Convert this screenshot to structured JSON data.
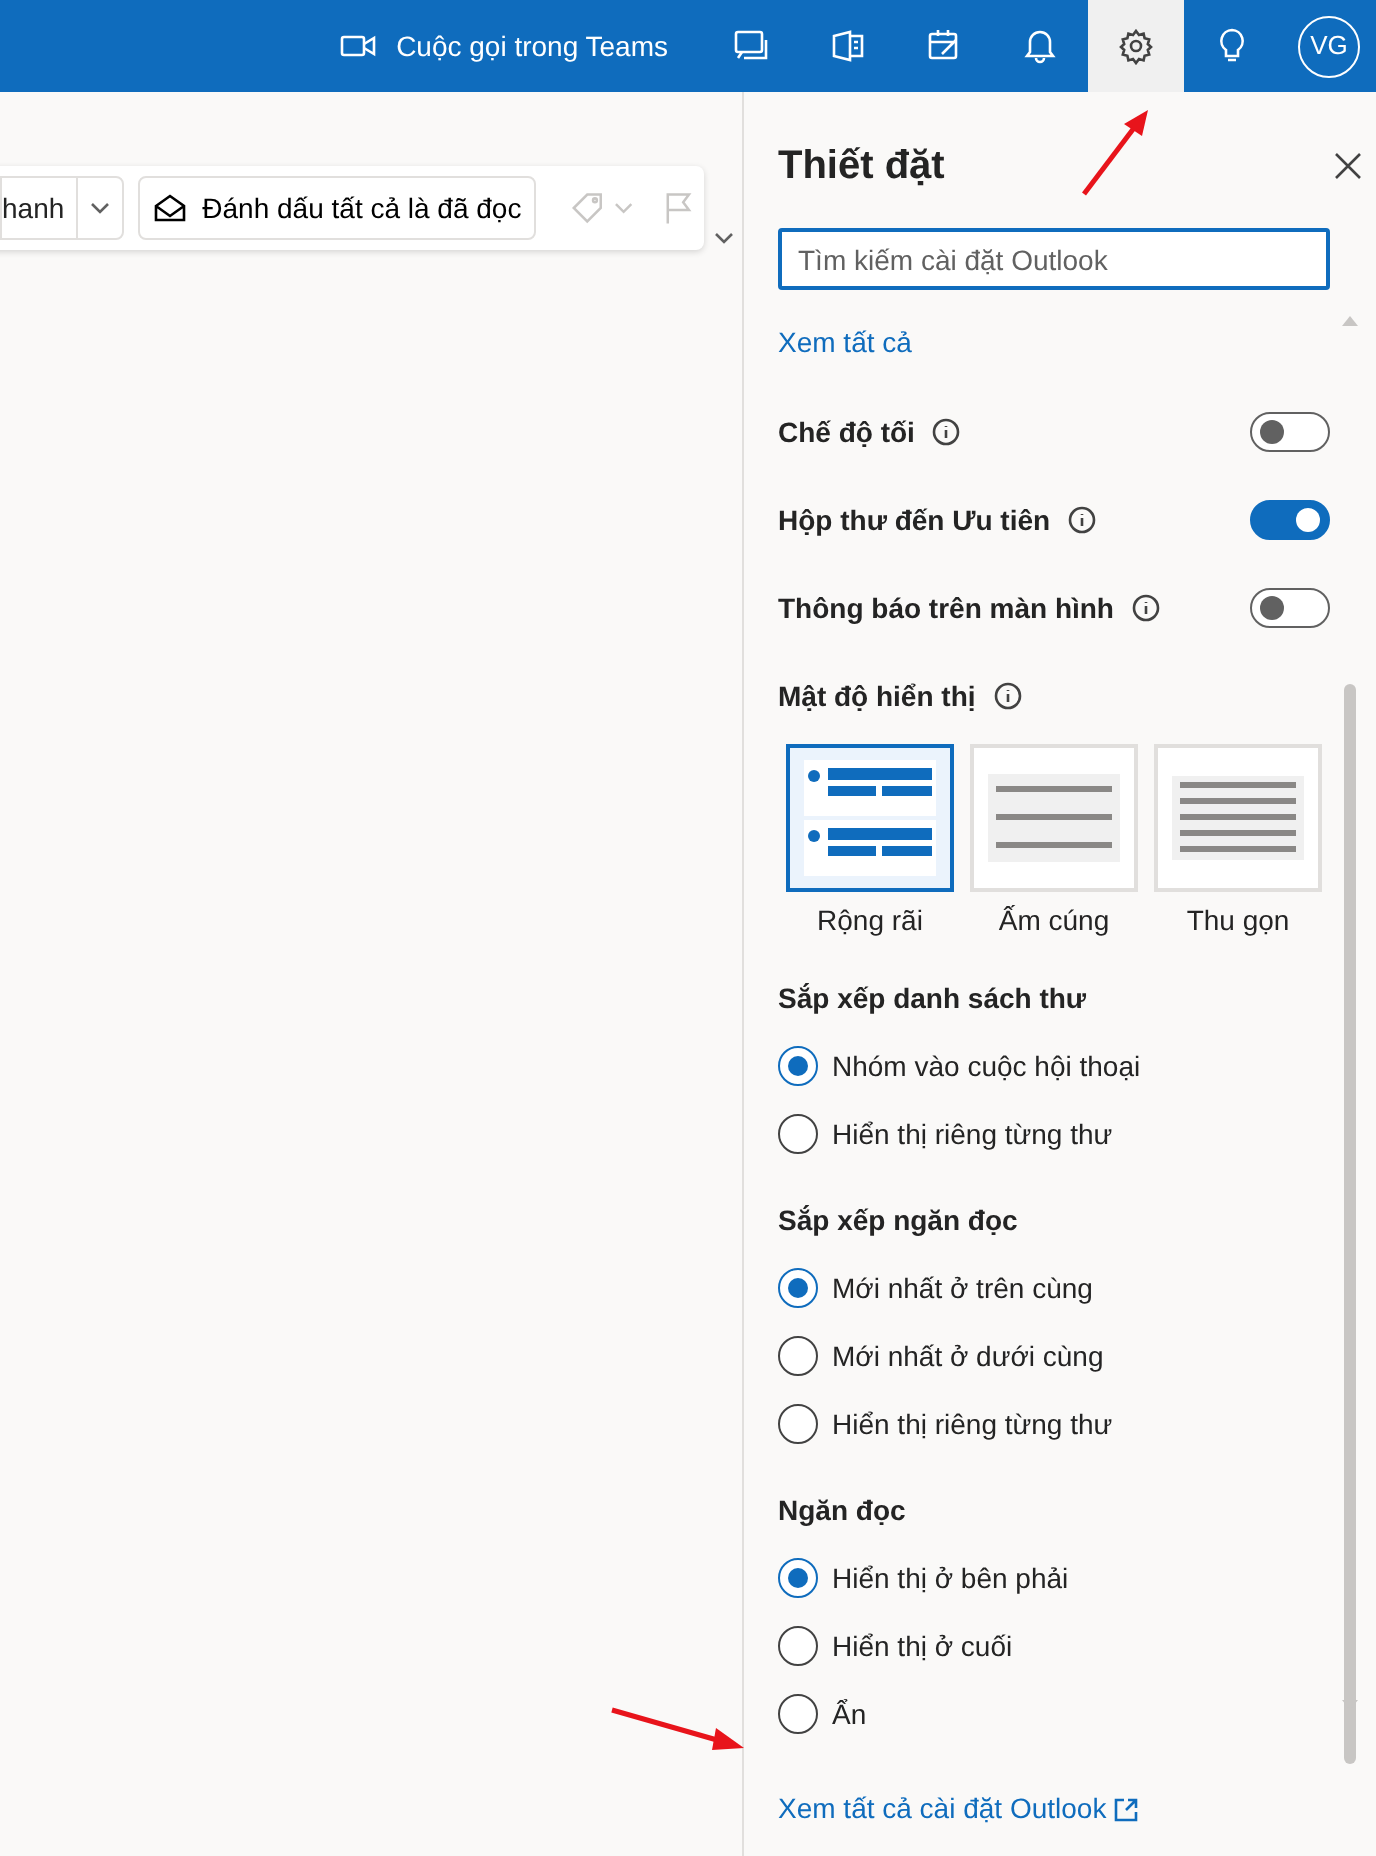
{
  "top_bar": {
    "teams_call": "Cuộc gọi trong Teams",
    "buttons": [
      {
        "kind": "chat",
        "selected": false
      },
      {
        "kind": "office",
        "selected": false
      },
      {
        "kind": "todo",
        "selected": false
      },
      {
        "kind": "bell",
        "selected": false
      },
      {
        "kind": "gear",
        "selected": true
      },
      {
        "kind": "bulb",
        "selected": false
      }
    ],
    "avatar": "VG"
  },
  "toolbar": {
    "partial_button": "hanh",
    "mark_read": "Đánh dấu tất cả là đã đọc"
  },
  "settings": {
    "title": "Thiết đặt",
    "search": {
      "placeholder": "Tìm kiếm cài đặt Outlook"
    },
    "view_all": "Xem tất cả",
    "toggles": [
      {
        "label": "Chế độ tối",
        "on": false
      },
      {
        "label": "Hộp thư đến Ưu tiên",
        "on": true
      },
      {
        "label": "Thông báo trên màn hình",
        "on": false
      }
    ],
    "density": {
      "label": "Mật độ hiển thị",
      "options": [
        {
          "label": "Rộng rãi",
          "kind": "spacious",
          "selected": true
        },
        {
          "label": "Ấm cúng",
          "kind": "cozy",
          "selected": false
        },
        {
          "label": "Thu gọn",
          "kind": "compact",
          "selected": false
        }
      ]
    },
    "groups": [
      {
        "title": "Sắp xếp danh sách thư",
        "options": [
          {
            "label": "Nhóm vào cuộc hội thoại",
            "selected": true
          },
          {
            "label": "Hiển thị riêng từng thư",
            "selected": false
          }
        ]
      },
      {
        "title": "Sắp xếp ngăn đọc",
        "options": [
          {
            "label": "Mới nhất ở trên cùng",
            "selected": true
          },
          {
            "label": "Mới nhất ở dưới cùng",
            "selected": false
          },
          {
            "label": "Hiển thị riêng từng thư",
            "selected": false
          }
        ]
      },
      {
        "title": "Ngăn đọc",
        "options": [
          {
            "label": "Hiển thị ở bên phải",
            "selected": true
          },
          {
            "label": "Hiển thị ở cuối",
            "selected": false
          },
          {
            "label": "Ẩn",
            "selected": false
          }
        ]
      }
    ],
    "footer_link": "Xem tất cả cài đặt Outlook"
  }
}
